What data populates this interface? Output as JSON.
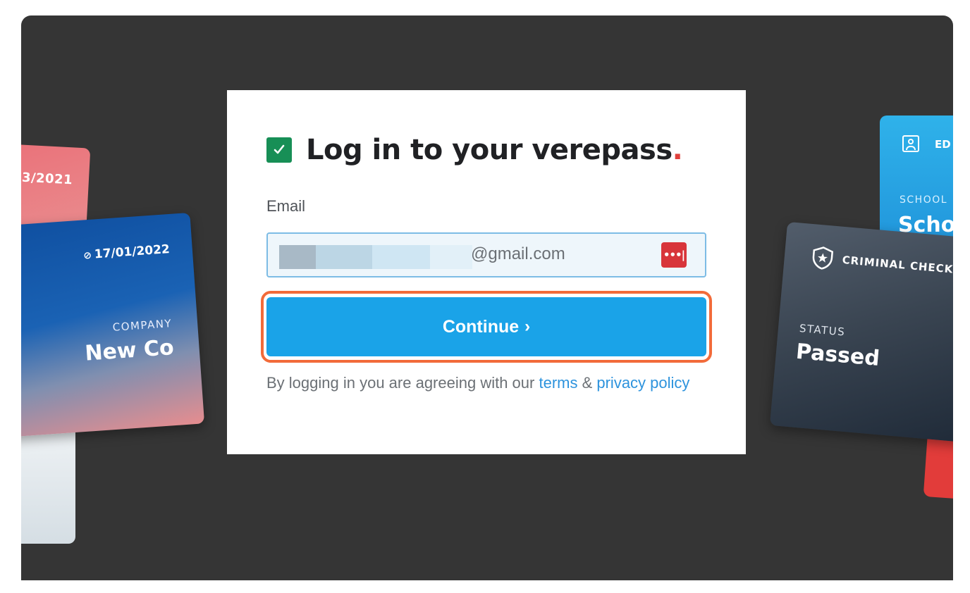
{
  "background_cards": {
    "red_card_date": "3/2021",
    "company_card": {
      "date": "17/01/2022",
      "caption": "COMPANY",
      "value": "New Co"
    },
    "education_card": {
      "header": "ED",
      "caption": "SCHOOL",
      "value": "Scho"
    },
    "criminal_card": {
      "title": "CRIMINAL CHECK",
      "caption": "STATUS",
      "value": "Passed"
    }
  },
  "login": {
    "title": "Log in to your verepass",
    "title_dot": ".",
    "email_label": "Email",
    "email_value": "@gmail.com",
    "password_manager_icon": "•••|",
    "continue_label": "Continue",
    "continue_icon": "›",
    "terms_prefix": "By logging in you are agreeing with our ",
    "terms_link": "terms",
    "terms_amp": " & ",
    "privacy_link": "privacy policy"
  },
  "colors": {
    "brand_check": "#178f56",
    "button": "#1aa3e8",
    "highlight": "#f26b3a",
    "link": "#2d93dd"
  }
}
